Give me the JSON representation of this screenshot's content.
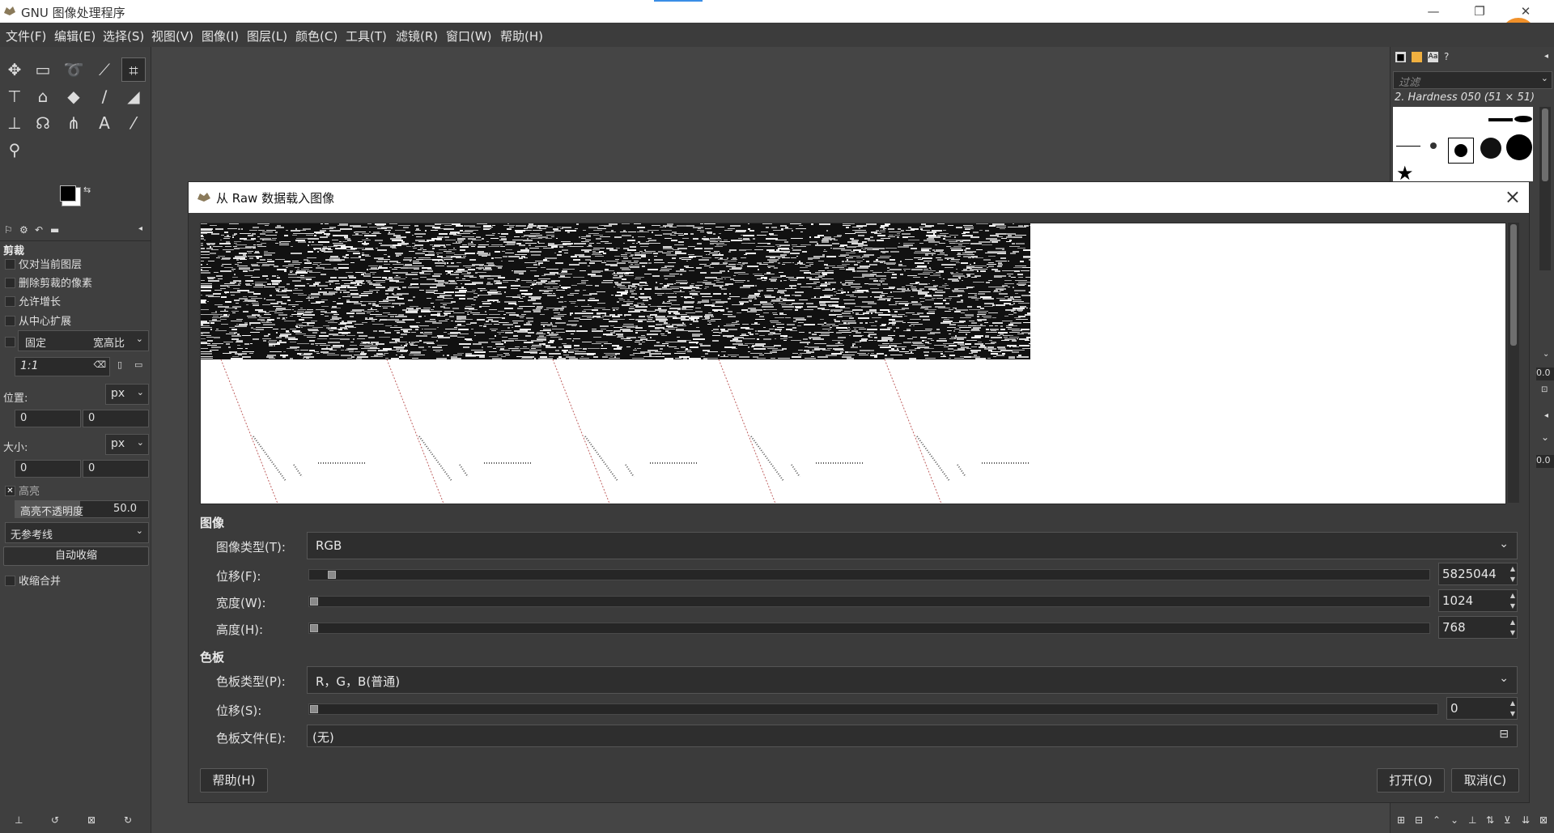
{
  "window": {
    "title": "GNU 图像处理程序",
    "controls": {
      "minimize": "—",
      "maximize": "❐",
      "close": "✕"
    }
  },
  "menubar": [
    "文件(F)",
    "编辑(E)",
    "选择(S)",
    "视图(V)",
    "图像(I)",
    "图层(L)",
    "颜色(C)",
    "工具(T)",
    "滤镜(R)",
    "窗口(W)",
    "帮助(H)"
  ],
  "tool_options": {
    "title": "剪裁",
    "opt_current_layer": "仅对当前图层",
    "opt_delete_pixels": "删除剪裁的像素",
    "opt_allow_grow": "允许增长",
    "opt_expand_center": "从中心扩展",
    "fixed_label": "固定",
    "fixed_mode": "宽高比",
    "ratio_value": "1:1",
    "position_label": "位置:",
    "size_label": "大小:",
    "unit": "px",
    "pos_x": "0",
    "pos_y": "0",
    "size_x": "0",
    "size_y": "0",
    "highlight_label": "高亮",
    "highlight_opacity_label": "高亮不透明度",
    "highlight_opacity_value": "50.0",
    "guides": "无参考线",
    "auto_shrink": "自动收缩",
    "shrink_merged": "收缩合并"
  },
  "brushes": {
    "filter_placeholder": "过滤",
    "brush_name": "2. Hardness 050 (51 × 51)",
    "right_values": [
      "0.0",
      "0.0"
    ]
  },
  "dialog": {
    "title": "从 Raw 数据载入图像",
    "section_image": "图像",
    "image_type_label": "图像类型(T):",
    "image_type_value": "RGB",
    "offset_label": "位移(F):",
    "offset_value": "5825044",
    "width_label": "宽度(W):",
    "width_value": "1024",
    "height_label": "高度(H):",
    "height_value": "768",
    "section_palette": "色板",
    "palette_type_label": "色板类型(P):",
    "palette_type_value": "R，G，B(普通)",
    "palette_offset_label": "位移(S):",
    "palette_offset_value": "0",
    "palette_file_label": "色板文件(E):",
    "palette_file_value": "(无)",
    "help_button": "帮助(H)",
    "open_button": "打开(O)",
    "cancel_button": "取消(C)",
    "offset_fraction": 0.017
  }
}
